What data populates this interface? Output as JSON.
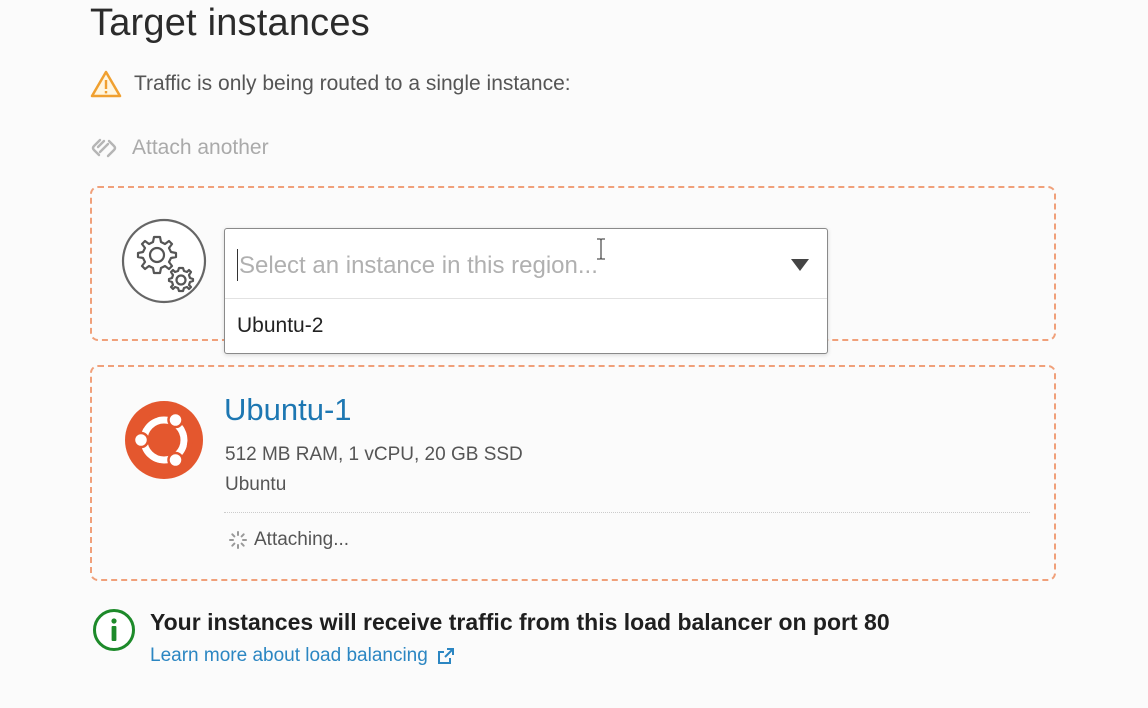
{
  "section": {
    "title": "Target instances"
  },
  "warning": {
    "text": "Traffic is only being routed to a single instance:",
    "icon": "warning-triangle-icon",
    "color": "#f0a030"
  },
  "attach": {
    "label": "Attach another",
    "icon": "attach-link-icon"
  },
  "selector": {
    "placeholder": "Select an instance in this region...",
    "value": "",
    "icon": "gears-icon",
    "options": [
      "Ubuntu-2"
    ]
  },
  "instance": {
    "name": "Ubuntu-1",
    "specs": "512 MB RAM, 1 vCPU, 20 GB SSD",
    "os": "Ubuntu",
    "status": "Attaching...",
    "icon": "ubuntu-logo-icon",
    "logo_color": "#e4572e"
  },
  "info": {
    "text": "Your instances will receive traffic from this load balancer on port 80",
    "link_label": "Learn more about load balancing",
    "icon": "info-icon",
    "icon_color": "#1d8a2a",
    "link_color": "#2b86c2"
  },
  "colors": {
    "panel_border": "#f0a07a",
    "link": "#1d77b2"
  }
}
